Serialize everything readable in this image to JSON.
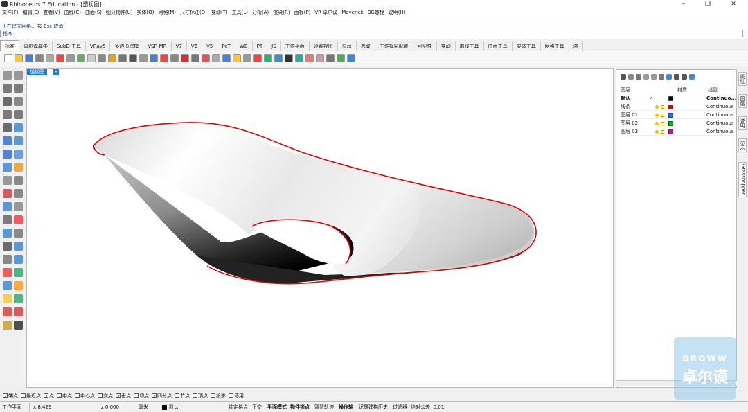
{
  "window": {
    "title": "Rhinoceros 7 Education - [透视图]",
    "minimize": "–",
    "maximize": "❐",
    "close": "✕"
  },
  "menu": [
    "文件(F)",
    "编辑(E)",
    "查看(V)",
    "曲线(C)",
    "曲面(S)",
    "细分物件(U)",
    "实体(O)",
    "网格(M)",
    "尺寸标注(D)",
    "变动(T)",
    "工具(L)",
    "分析(A)",
    "渲染(R)",
    "面板(P)",
    "VR-卓尔谟",
    "Maverick",
    "BG螺栓",
    "说明(H)"
  ],
  "command": {
    "history": "正在建立网格... 按 Esc 取消",
    "prompt": "指令:"
  },
  "tabs": [
    "标准",
    "卓尔谟犀牛",
    "SubD 工具",
    "VRay5",
    "多边形建模",
    "VSR-MR",
    "V7",
    "V6",
    "V5",
    "PeT",
    "WB",
    "PT",
    "JS",
    "工作平面",
    "设置视图",
    "显示",
    "选取",
    "工作视窗配置",
    "可见性",
    "变动",
    "曲线工具",
    "曲面工具",
    "实体工具",
    "网格工具",
    "渲"
  ],
  "viewport": {
    "label": "透视图",
    "arrow": "▾"
  },
  "layers": {
    "headers": {
      "name": "图层",
      "material": "材质",
      "linetype": "线型"
    },
    "rows": [
      {
        "name": "默认",
        "current": "✓",
        "color": "#000000",
        "linetype": "Continuo...",
        "bold": true
      },
      {
        "name": "线条",
        "current": "",
        "color": "#e00000",
        "linetype": "Continuous",
        "bold": false
      },
      {
        "name": "图层 01",
        "current": "",
        "color": "#1a6cff",
        "linetype": "Continuous",
        "bold": false
      },
      {
        "name": "图层 02",
        "current": "",
        "color": "#00c000",
        "linetype": "Continuous",
        "bold": false
      },
      {
        "name": "图层 03",
        "current": "",
        "color": "#e000a0",
        "linetype": "Continuous",
        "bold": false
      }
    ]
  },
  "side_tabs": [
    "属性",
    "图层",
    "说明",
    "显示",
    "Grasshopper"
  ],
  "osnaps": [
    {
      "label": "端点",
      "on": true
    },
    {
      "label": "最近点",
      "on": false
    },
    {
      "label": "点",
      "on": true
    },
    {
      "label": "中点",
      "on": true
    },
    {
      "label": "中心点",
      "on": false
    },
    {
      "label": "交点",
      "on": false
    },
    {
      "label": "垂点",
      "on": true
    },
    {
      "label": "切点",
      "on": false
    },
    {
      "label": "四分点",
      "on": true
    },
    {
      "label": "节点",
      "on": false
    },
    {
      "label": "顶点",
      "on": false
    },
    {
      "label": "投影",
      "on": false
    },
    {
      "label": "停用",
      "on": false
    }
  ],
  "status": {
    "cplane": "工作平面",
    "x": "x 8.429",
    "z": "z 0.000",
    "unit": "毫米",
    "layer": "默认",
    "grid_snap": "锁定格点",
    "ortho": "正交",
    "planar": "平面模式",
    "osnap": "物件锁点",
    "smarttrack": "智慧轨迹",
    "gumball": "操作轴",
    "history": "记录建构历史",
    "filter": "过滤器",
    "tolerance": "绝对公差: 0.01"
  },
  "watermark": {
    "line1": "DROWW",
    "line2": "卓尔谟"
  },
  "colors": {
    "accent": "#1e7bd8",
    "curve": "#e00000"
  }
}
